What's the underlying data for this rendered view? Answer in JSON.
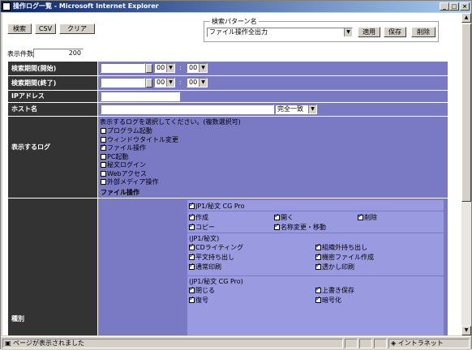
{
  "window": {
    "title": "操作ログ一覧 - Microsoft Internet Explorer",
    "min": "_",
    "max": "□",
    "close": "×"
  },
  "toolbar": {
    "search": "検索",
    "csv": "CSV",
    "clear": "クリア"
  },
  "pattern": {
    "legend": "検索パターン名",
    "value": "ファイル操作全出力",
    "apply": "適用",
    "save": "保存",
    "delete": "削除"
  },
  "count": {
    "label": "表示件数",
    "value": "200"
  },
  "rows": {
    "start": "検索期間(開始)",
    "end": "検索期間(終了)",
    "ip": "IPアドレス",
    "host": "ホスト名",
    "logs": "表示するログ",
    "kind": "種別"
  },
  "time": {
    "hour": "00",
    "min": "00",
    "colon": ":"
  },
  "host_match": "完全一致",
  "logs": {
    "prompt": "表示するログを選択してください。(複数選択可)",
    "items": [
      {
        "label": "プログラム起動",
        "checked": false
      },
      {
        "label": "ウィンドウタイトル変更",
        "checked": false
      },
      {
        "label": "ファイル操作",
        "checked": true
      },
      {
        "label": "PC起動",
        "checked": false
      },
      {
        "label": "秘文ログイン",
        "checked": false
      },
      {
        "label": "Webアクセス",
        "checked": false
      },
      {
        "label": "外部メディア操作",
        "checked": false
      }
    ],
    "section": "ファイル操作"
  },
  "file_ops": {
    "header": "JP1/秘文 CG Pro",
    "common": [
      {
        "label": "作成",
        "checked": true
      },
      {
        "label": "開く",
        "checked": true
      },
      {
        "label": "削除",
        "checked": true
      },
      {
        "label": "コピー",
        "checked": true
      },
      {
        "label": "名称変更・移動",
        "checked": true
      }
    ],
    "hibun_title": "(JP1/秘文)",
    "hibun": [
      {
        "label": "CDライティング",
        "checked": true
      },
      {
        "label": "組織外持ち出し",
        "checked": true
      },
      {
        "label": "平文持ち出し",
        "checked": true
      },
      {
        "label": "機密ファイル作成",
        "checked": true
      },
      {
        "label": "通常印刷",
        "checked": true
      },
      {
        "label": "透かし印刷",
        "checked": true
      }
    ],
    "cg_title": "(JP1/秘文 CG Pro)",
    "cg": [
      {
        "label": "閉じる",
        "checked": true
      },
      {
        "label": "上書き保存",
        "checked": true
      },
      {
        "label": "復号",
        "checked": true
      },
      {
        "label": "暗号化",
        "checked": true
      }
    ]
  },
  "status": {
    "text": "ページが表示されました",
    "zone": "イントラネット"
  }
}
